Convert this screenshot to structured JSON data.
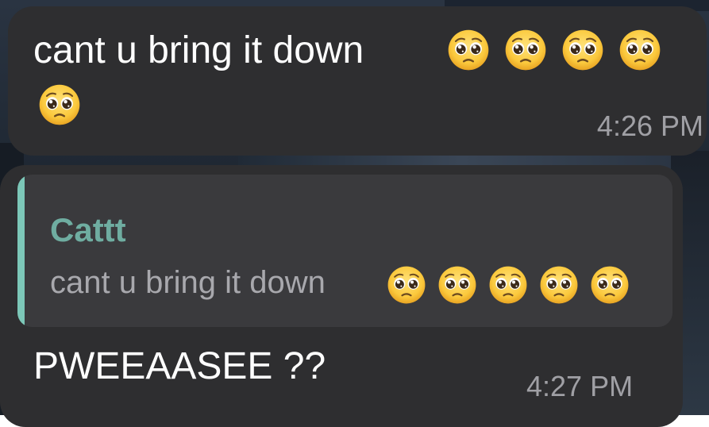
{
  "messages": [
    {
      "text": "cant u bring it down",
      "emoji": "pleading-face",
      "emoji_count": 5,
      "time": "4:26 PM"
    },
    {
      "reply_to": {
        "author": "Cattt",
        "text": "cant u bring it down",
        "emoji": "pleading-face",
        "emoji_count": 5
      },
      "text": "PWEEAASEE ??",
      "time": "4:27 PM"
    }
  ],
  "colors": {
    "bubble": "#2e2e30",
    "reply_background": "#3a3a3d",
    "reply_bar": "#7cc7b8",
    "reply_author": "#6fada1",
    "timestamp": "#a0a0a5"
  }
}
